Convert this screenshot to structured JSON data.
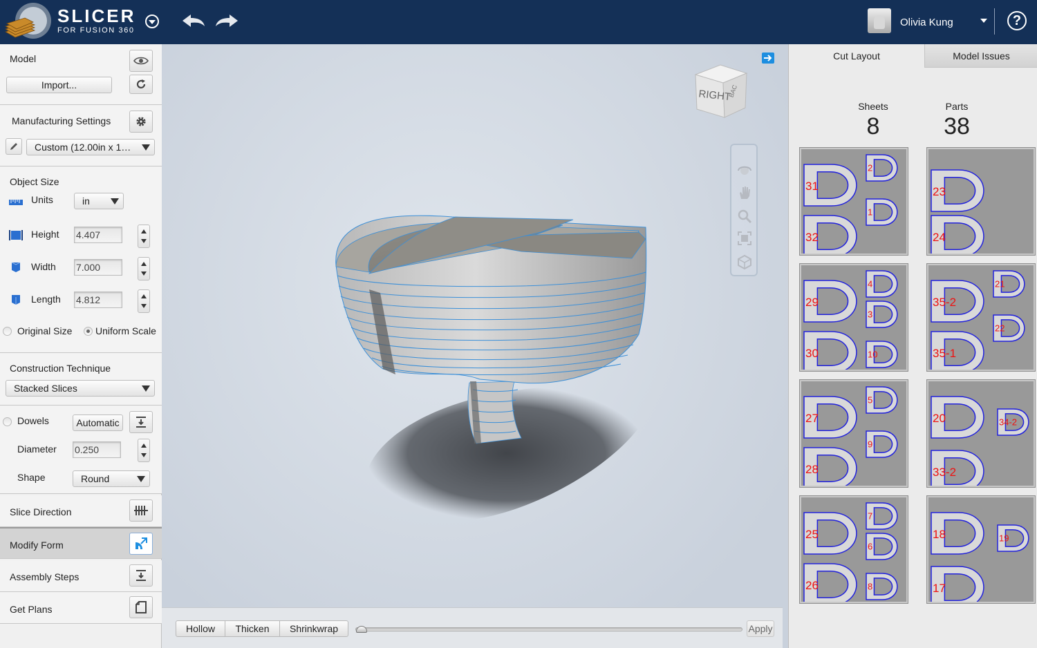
{
  "header": {
    "brand": "SLICER",
    "subbrand": "FOR FUSION 360",
    "user_name": "Olivia Kung",
    "help": "?"
  },
  "model": {
    "title": "Model",
    "import_label": "Import..."
  },
  "manufacturing": {
    "title": "Manufacturing Settings",
    "preset": "Custom (12.00in x 1…"
  },
  "object_size": {
    "title": "Object Size",
    "units_label": "Units",
    "units_value": "in",
    "height_label": "Height",
    "height_value": "4.407",
    "width_label": "Width",
    "width_value": "7.000",
    "length_label": "Length",
    "length_value": "4.812",
    "original_size_label": "Original Size",
    "uniform_scale_label": "Uniform Scale"
  },
  "construction": {
    "title": "Construction Technique",
    "value": "Stacked Slices"
  },
  "dowels": {
    "label": "Dowels",
    "mode": "Automatic",
    "diameter_label": "Diameter",
    "diameter_value": "0.250",
    "shape_label": "Shape",
    "shape_value": "Round"
  },
  "nav": {
    "slice_direction": "Slice Direction",
    "modify_form": "Modify Form",
    "assembly_steps": "Assembly Steps",
    "get_plans": "Get Plans"
  },
  "viewcube": {
    "face_label": "RIGHT",
    "side_label": "BAC"
  },
  "bottom_bar": {
    "hollow": "Hollow",
    "thicken": "Thicken",
    "shrinkwrap": "Shrinkwrap",
    "apply": "Apply"
  },
  "right_panel": {
    "tab_active": "Cut Layout",
    "tab_inactive": "Model Issues",
    "sheets_label": "Sheets",
    "sheets_value": "8",
    "parts_label": "Parts",
    "parts_value": "38"
  },
  "colors": {
    "header_bg": "#143057",
    "accent": "#1d8ee0",
    "part_outline": "#2222dd",
    "part_label": "#ee1111"
  },
  "sheets": [
    {
      "labels": [
        "31",
        "2",
        "32",
        "1"
      ]
    },
    {
      "labels": [
        "23",
        "24"
      ]
    },
    {
      "labels": [
        "29",
        "4",
        "3",
        "30",
        "10"
      ]
    },
    {
      "labels": [
        "35-2",
        "21",
        "35-1",
        "22"
      ]
    },
    {
      "labels": [
        "27",
        "5",
        "28",
        "9"
      ]
    },
    {
      "labels": [
        "20",
        "34-2",
        "33-2"
      ]
    },
    {
      "labels": [
        "25",
        "7",
        "6",
        "26",
        "8"
      ]
    },
    {
      "labels": [
        "18",
        "19",
        "17"
      ]
    }
  ]
}
